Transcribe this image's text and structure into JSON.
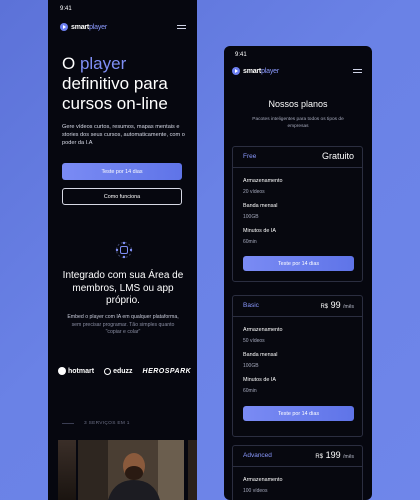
{
  "left_phone": {
    "status_time": "9:41",
    "logo": {
      "bold": "smart",
      "accent": "player"
    },
    "hero": {
      "title_pre": "O ",
      "title_accent": "player",
      "title_post": " definitivo para cursos on-line",
      "description": "Gere vídeos curtos, resumos, mapas mentais e stories dos seus cursos, automaticamente, com o poder da I.A"
    },
    "cta_primary": "Teste por 14 dias",
    "cta_secondary": "Como funciona",
    "integrations": {
      "icon": "connect-icon",
      "title": "Integrado com sua Área de membros, LMS ou app próprio.",
      "desc_main": "Embed o player com IA em qualquer plataforma,",
      "desc_muted": " sem precisar programar. Tão simples quanto \"copiar e colar\""
    },
    "partners": [
      "hotmart",
      "eduzz",
      "HEROSPARK"
    ],
    "services_label": "3 SERVIÇOS EM 1"
  },
  "right_phone": {
    "status_time": "9:41",
    "logo": {
      "bold": "smart",
      "accent": "player"
    },
    "title": "Nossos planos",
    "subtitle": "Pacotes inteligentes para todos os tipos de empresas",
    "plans": [
      {
        "name": "Free",
        "price_text": "Gratuito",
        "features": [
          {
            "label": "Armazenamento",
            "value": "20 vídeos"
          },
          {
            "label": "Banda mensal",
            "value": "100GB"
          },
          {
            "label": "Minutos de IA",
            "value": "60min"
          }
        ],
        "cta": "Teste por 14 dias"
      },
      {
        "name": "Basic",
        "currency": "R$",
        "price": "99",
        "period": "/mês",
        "features": [
          {
            "label": "Armazenamento",
            "value": "50 vídeos"
          },
          {
            "label": "Banda mensal",
            "value": "100GB"
          },
          {
            "label": "Minutos de IA",
            "value": "60min"
          }
        ],
        "cta": "Teste por 14 dias"
      },
      {
        "name": "Advanced",
        "currency": "R$",
        "price": "199",
        "period": "/mês",
        "features": [
          {
            "label": "Armazenamento",
            "value": "100 vídeos"
          }
        ]
      }
    ]
  },
  "colors": {
    "background": "#6a82e6",
    "phone": "#06070f",
    "accent": "#7f8ff6",
    "button": "#6f82f0"
  }
}
